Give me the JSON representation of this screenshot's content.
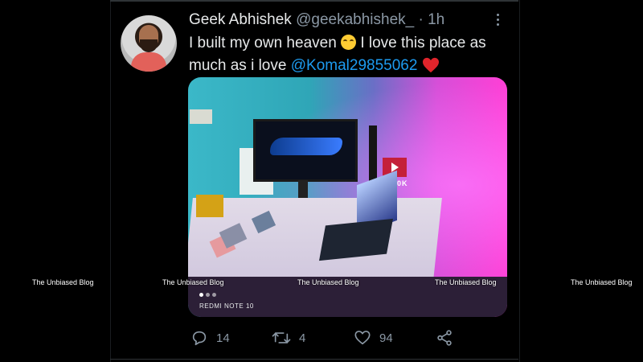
{
  "tweet": {
    "author_name": "Geek Abhishek",
    "author_handle": "@geekabhishek_",
    "separator": "·",
    "time": "1h",
    "text_part1": "I built my own heaven ",
    "text_part2": " I love this place as much as i love ",
    "mention": "@Komal29855062",
    "emoji_icons": [
      "smiling-face-icon",
      "red-heart-icon"
    ],
    "image": {
      "camera_tag": "REDMI NOTE 10",
      "badge_text": "200K",
      "pager_count": 3
    },
    "stats": {
      "replies": "14",
      "retweets": "4",
      "likes": "94"
    }
  },
  "watermarks": [
    "The Unbiased Blog",
    "The Unbiased Blog",
    "The Unbiased Blog",
    "The Unbiased Blog",
    "The Unbiased Blog"
  ],
  "colors": {
    "background": "#000000",
    "text": "#e7e9ea",
    "muted": "#8b98a5",
    "link": "#1d9bf0",
    "heart": "#f91880"
  }
}
